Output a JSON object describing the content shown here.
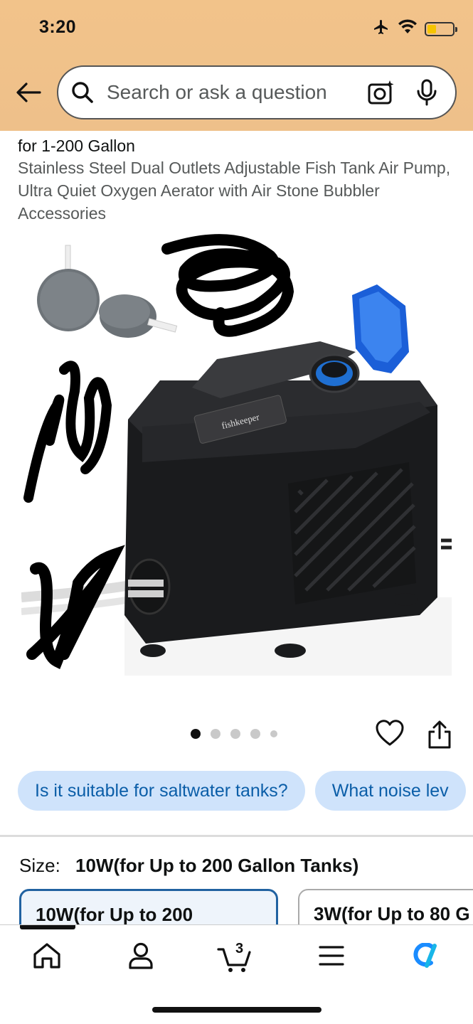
{
  "status_bar": {
    "time": "3:20",
    "icons": [
      "airplane-icon",
      "wifi-icon",
      "battery-icon"
    ]
  },
  "search": {
    "placeholder": "Search or ask a question",
    "icons": [
      "back-arrow-icon",
      "search-icon",
      "camera-icon",
      "mic-icon"
    ]
  },
  "product": {
    "title_truncated": "for 1-200 Gallon",
    "subtitle": "Stainless Steel Dual Outlets Adjustable Fish Tank Air Pump, Ultra Quiet Oxygen Aerator with Air Stone Bubbler Accessories",
    "image_brand_text": "fishkeeper",
    "image_count": 5,
    "active_image_index": 0
  },
  "questions": [
    "Is it suitable for saltwater tanks?",
    "What noise lev"
  ],
  "size": {
    "label": "Size:",
    "selected_value": "10W(for Up to 200 Gallon Tanks)",
    "options": [
      "10W(for Up to 200",
      "3W(for Up to 80 G"
    ]
  },
  "bottom_nav": {
    "items": [
      "home-icon",
      "account-icon",
      "cart-icon",
      "menu-icon",
      "rufus-icon"
    ],
    "cart_count": "3"
  },
  "colors": {
    "header_bg": "#f2c38a",
    "chip_bg": "#cfe3fb",
    "chip_text": "#0b5ea8",
    "selected_border": "#2162a1"
  }
}
